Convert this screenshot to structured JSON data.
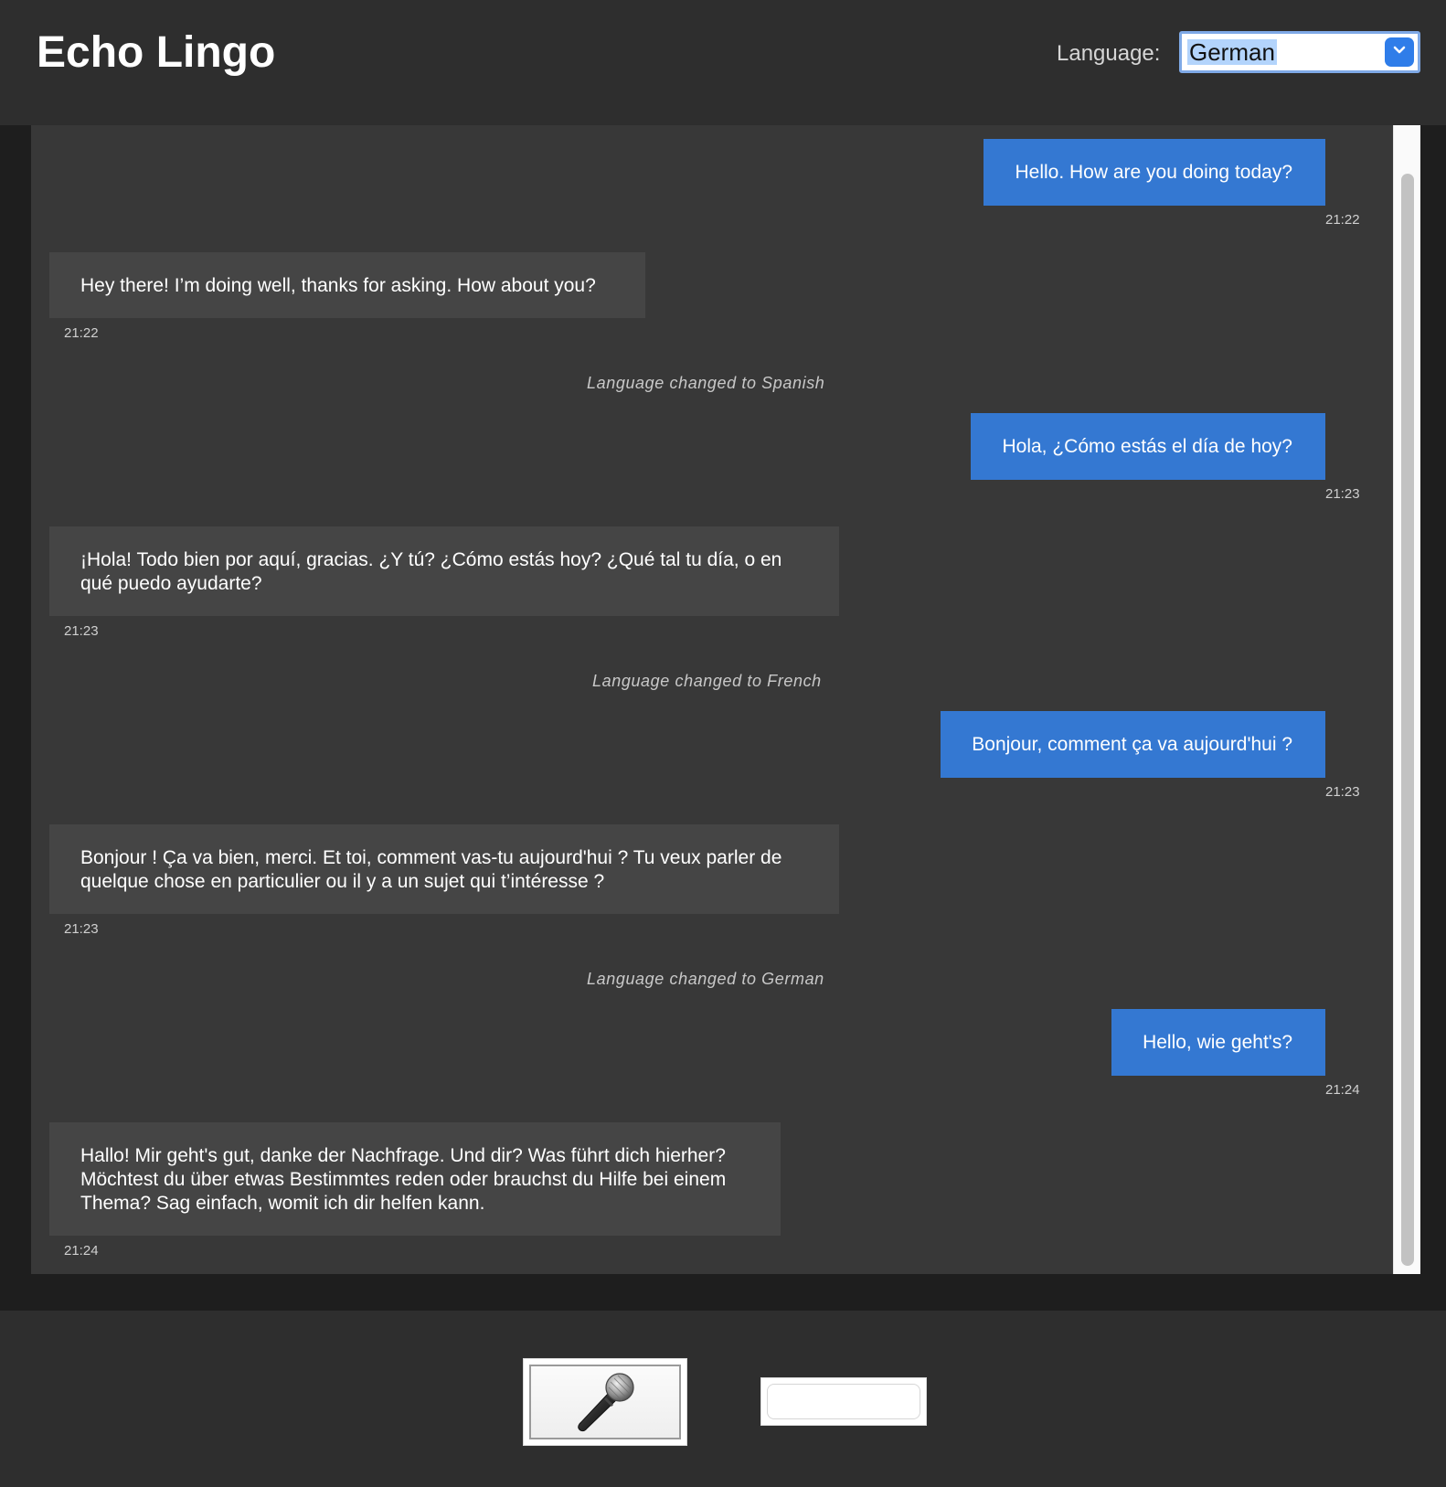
{
  "header": {
    "title": "Echo Lingo",
    "language_label": "Language:",
    "language_selected": "German"
  },
  "messages": [
    {
      "role": "user",
      "text": "Hello. How are you doing today?",
      "time": "21:22"
    },
    {
      "role": "bot",
      "text": "Hey there! I’m doing well, thanks for asking. How about you?",
      "time": "21:22"
    },
    {
      "role": "notice",
      "text": "Language changed to Spanish"
    },
    {
      "role": "user",
      "text": "Hola, ¿Cómo estás el día de hoy?",
      "time": "21:23"
    },
    {
      "role": "bot",
      "text": "¡Hola! Todo bien por aquí, gracias. ¿Y tú? ¿Cómo estás hoy? ¿Qué tal tu día, o en qué puedo ayudarte?",
      "time": "21:23"
    },
    {
      "role": "notice",
      "text": "Language changed to French"
    },
    {
      "role": "user",
      "text": "Bonjour, comment ça va aujourd'hui ?",
      "time": "21:23"
    },
    {
      "role": "bot",
      "text": "Bonjour ! Ça va bien, merci. Et toi, comment vas-tu aujourd'hui ? Tu veux parler de quelque chose en particulier ou il y a un sujet qui t’intéresse ?",
      "time": "21:23"
    },
    {
      "role": "notice",
      "text": "Language changed to German"
    },
    {
      "role": "user",
      "text": "Hello, wie geht's?",
      "time": "21:24"
    },
    {
      "role": "bot",
      "text": "Hallo! Mir geht's gut, danke der Nachfrage. Und dir? Was führt dich hierher? Möchtest du über etwas Bestimmtes reden oder brauchst du Hilfe bei einem Thema? Sag einfach, womit ich dir helfen kann.",
      "time": "21:24"
    }
  ],
  "footer": {
    "mic_icon": "microphone-icon",
    "text_input_value": ""
  },
  "colors": {
    "user_bubble": "#3478d2",
    "bot_bubble": "#454545",
    "chat_background": "#383838",
    "header_background": "#2e2e2e"
  }
}
